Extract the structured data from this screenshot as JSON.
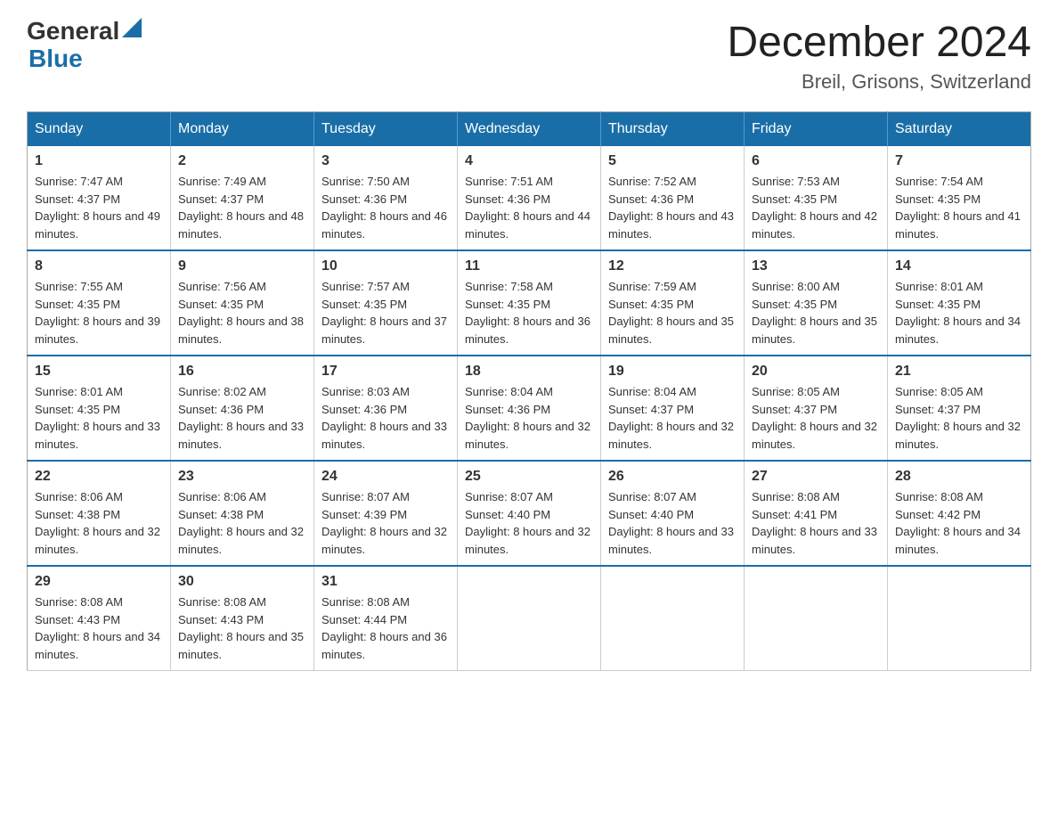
{
  "header": {
    "logo_general": "General",
    "logo_blue": "Blue",
    "month_title": "December 2024",
    "location": "Breil, Grisons, Switzerland"
  },
  "days_of_week": [
    "Sunday",
    "Monday",
    "Tuesday",
    "Wednesday",
    "Thursday",
    "Friday",
    "Saturday"
  ],
  "weeks": [
    [
      {
        "day": "1",
        "sunrise": "7:47 AM",
        "sunset": "4:37 PM",
        "daylight": "8 hours and 49 minutes."
      },
      {
        "day": "2",
        "sunrise": "7:49 AM",
        "sunset": "4:37 PM",
        "daylight": "8 hours and 48 minutes."
      },
      {
        "day": "3",
        "sunrise": "7:50 AM",
        "sunset": "4:36 PM",
        "daylight": "8 hours and 46 minutes."
      },
      {
        "day": "4",
        "sunrise": "7:51 AM",
        "sunset": "4:36 PM",
        "daylight": "8 hours and 44 minutes."
      },
      {
        "day": "5",
        "sunrise": "7:52 AM",
        "sunset": "4:36 PM",
        "daylight": "8 hours and 43 minutes."
      },
      {
        "day": "6",
        "sunrise": "7:53 AM",
        "sunset": "4:35 PM",
        "daylight": "8 hours and 42 minutes."
      },
      {
        "day": "7",
        "sunrise": "7:54 AM",
        "sunset": "4:35 PM",
        "daylight": "8 hours and 41 minutes."
      }
    ],
    [
      {
        "day": "8",
        "sunrise": "7:55 AM",
        "sunset": "4:35 PM",
        "daylight": "8 hours and 39 minutes."
      },
      {
        "day": "9",
        "sunrise": "7:56 AM",
        "sunset": "4:35 PM",
        "daylight": "8 hours and 38 minutes."
      },
      {
        "day": "10",
        "sunrise": "7:57 AM",
        "sunset": "4:35 PM",
        "daylight": "8 hours and 37 minutes."
      },
      {
        "day": "11",
        "sunrise": "7:58 AM",
        "sunset": "4:35 PM",
        "daylight": "8 hours and 36 minutes."
      },
      {
        "day": "12",
        "sunrise": "7:59 AM",
        "sunset": "4:35 PM",
        "daylight": "8 hours and 35 minutes."
      },
      {
        "day": "13",
        "sunrise": "8:00 AM",
        "sunset": "4:35 PM",
        "daylight": "8 hours and 35 minutes."
      },
      {
        "day": "14",
        "sunrise": "8:01 AM",
        "sunset": "4:35 PM",
        "daylight": "8 hours and 34 minutes."
      }
    ],
    [
      {
        "day": "15",
        "sunrise": "8:01 AM",
        "sunset": "4:35 PM",
        "daylight": "8 hours and 33 minutes."
      },
      {
        "day": "16",
        "sunrise": "8:02 AM",
        "sunset": "4:36 PM",
        "daylight": "8 hours and 33 minutes."
      },
      {
        "day": "17",
        "sunrise": "8:03 AM",
        "sunset": "4:36 PM",
        "daylight": "8 hours and 33 minutes."
      },
      {
        "day": "18",
        "sunrise": "8:04 AM",
        "sunset": "4:36 PM",
        "daylight": "8 hours and 32 minutes."
      },
      {
        "day": "19",
        "sunrise": "8:04 AM",
        "sunset": "4:37 PM",
        "daylight": "8 hours and 32 minutes."
      },
      {
        "day": "20",
        "sunrise": "8:05 AM",
        "sunset": "4:37 PM",
        "daylight": "8 hours and 32 minutes."
      },
      {
        "day": "21",
        "sunrise": "8:05 AM",
        "sunset": "4:37 PM",
        "daylight": "8 hours and 32 minutes."
      }
    ],
    [
      {
        "day": "22",
        "sunrise": "8:06 AM",
        "sunset": "4:38 PM",
        "daylight": "8 hours and 32 minutes."
      },
      {
        "day": "23",
        "sunrise": "8:06 AM",
        "sunset": "4:38 PM",
        "daylight": "8 hours and 32 minutes."
      },
      {
        "day": "24",
        "sunrise": "8:07 AM",
        "sunset": "4:39 PM",
        "daylight": "8 hours and 32 minutes."
      },
      {
        "day": "25",
        "sunrise": "8:07 AM",
        "sunset": "4:40 PM",
        "daylight": "8 hours and 32 minutes."
      },
      {
        "day": "26",
        "sunrise": "8:07 AM",
        "sunset": "4:40 PM",
        "daylight": "8 hours and 33 minutes."
      },
      {
        "day": "27",
        "sunrise": "8:08 AM",
        "sunset": "4:41 PM",
        "daylight": "8 hours and 33 minutes."
      },
      {
        "day": "28",
        "sunrise": "8:08 AM",
        "sunset": "4:42 PM",
        "daylight": "8 hours and 34 minutes."
      }
    ],
    [
      {
        "day": "29",
        "sunrise": "8:08 AM",
        "sunset": "4:43 PM",
        "daylight": "8 hours and 34 minutes."
      },
      {
        "day": "30",
        "sunrise": "8:08 AM",
        "sunset": "4:43 PM",
        "daylight": "8 hours and 35 minutes."
      },
      {
        "day": "31",
        "sunrise": "8:08 AM",
        "sunset": "4:44 PM",
        "daylight": "8 hours and 36 minutes."
      },
      null,
      null,
      null,
      null
    ]
  ],
  "labels": {
    "sunrise": "Sunrise: ",
    "sunset": "Sunset: ",
    "daylight": "Daylight: "
  }
}
